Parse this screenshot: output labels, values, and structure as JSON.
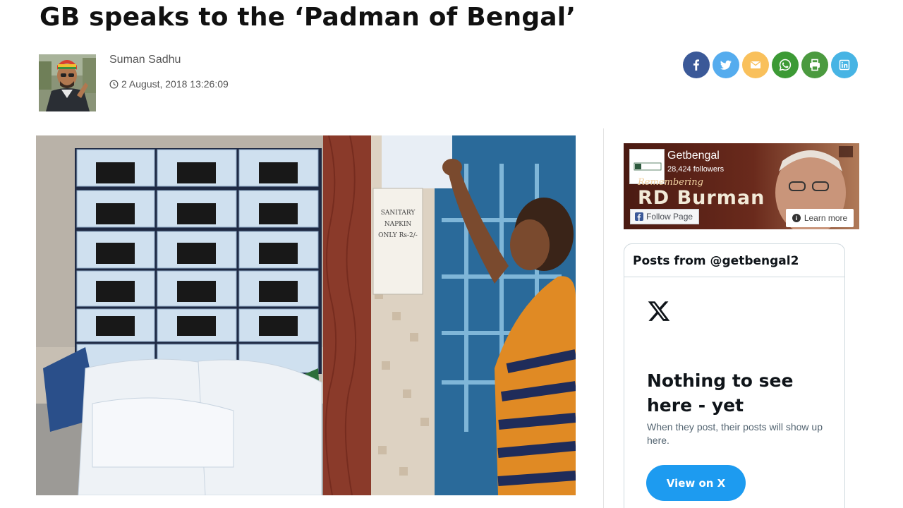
{
  "article": {
    "title": "GB speaks to the ‘Padman of Bengal’",
    "author": "Suman Sadhu",
    "date": "2 August, 2018 13:26:09",
    "photo_caption_text": [
      "SANITARY",
      "NAPKIN",
      "ONLY Rs-2/-"
    ]
  },
  "share_buttons": [
    {
      "name": "facebook",
      "icon": "facebook-icon",
      "color": "#3b5998"
    },
    {
      "name": "twitter",
      "icon": "twitter-icon",
      "color": "#55acee"
    },
    {
      "name": "email",
      "icon": "email-icon",
      "color": "#f9c05b"
    },
    {
      "name": "whatsapp",
      "icon": "whatsapp-icon",
      "color": "#3c9a35"
    },
    {
      "name": "print",
      "icon": "print-icon",
      "color": "#4b9a3f"
    },
    {
      "name": "linkedin",
      "icon": "linkedin-icon",
      "color": "#47b4e4"
    }
  ],
  "facebook_widget": {
    "page_name": "Getbengal",
    "followers": "28,424 followers",
    "banner_script": "Remembering",
    "banner_text": "RD Burman",
    "follow_label": "Follow Page",
    "learn_more_label": "Learn more",
    "logo_text": "GB Getbengal"
  },
  "x_widget": {
    "title": "Posts from @getbengal2",
    "empty_title": "Nothing to see here - yet",
    "empty_subtitle": "When they post, their posts will show up here.",
    "button_label": "View on X",
    "accent": "#1d9bf0"
  }
}
